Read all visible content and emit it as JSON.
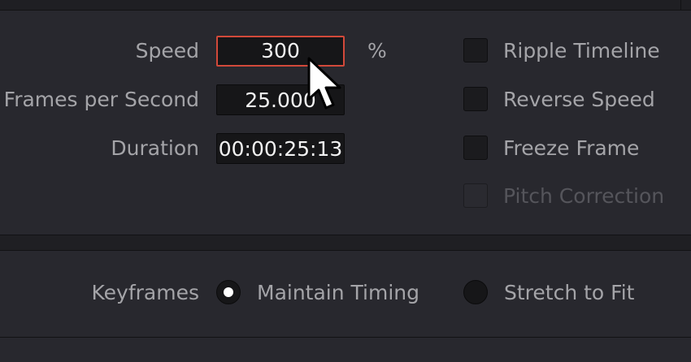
{
  "speed": {
    "label": "Speed",
    "value": "300",
    "unit": "%"
  },
  "fps": {
    "label": "Frames per Second",
    "value": "25.000"
  },
  "duration": {
    "label": "Duration",
    "value": "00:00:25:13"
  },
  "options": {
    "ripple_timeline": "Ripple Timeline",
    "reverse_speed": "Reverse Speed",
    "freeze_frame": "Freeze Frame",
    "pitch_correction": "Pitch Correction"
  },
  "keyframes": {
    "label": "Keyframes",
    "maintain_timing": "Maintain Timing",
    "stretch_to_fit": "Stretch to Fit",
    "selected": "maintain_timing"
  },
  "colors": {
    "active_border": "#d2493a",
    "background": "#28282e",
    "label": "#a4a4a8"
  },
  "icons": {
    "cursor": "mouse-pointer-icon"
  }
}
